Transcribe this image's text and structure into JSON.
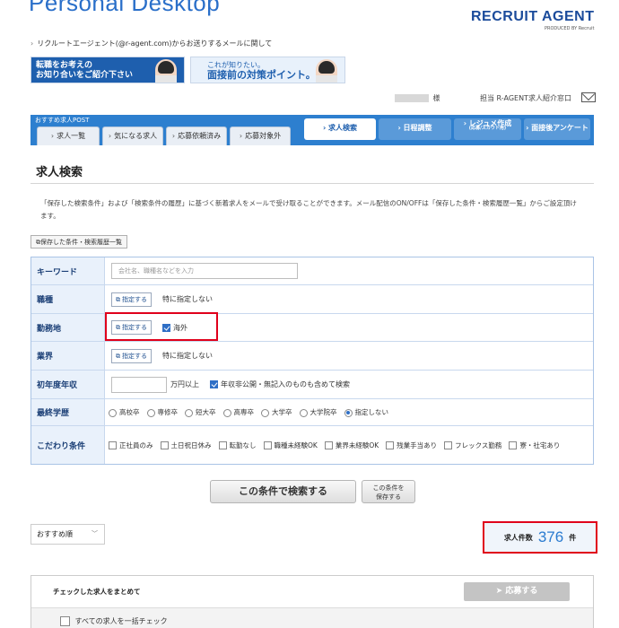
{
  "header": {
    "title": "Personal Desktop",
    "brand": "RECRUIT AGENT",
    "brand_sub": "PRODUCED BY Recruit"
  },
  "top_link": "リクルートエージェント(@r-agent.com)からお送りするメールに関して",
  "banners": {
    "left_line1": "転職をお考えの",
    "left_line2": "お知り合いをご紹介下さい",
    "right_line1": "これが知りたい。",
    "right_line2": "面接前の対策ポイント。"
  },
  "user": {
    "suffix": "様",
    "contact": "担当 R-AGENT求人紹介窓口"
  },
  "nav": {
    "label": "おすすめ求人POST",
    "tabs": [
      "求人一覧",
      "気になる求人",
      "応募依頼済み",
      "応募対象外"
    ],
    "buttons": {
      "search": "求人検索",
      "schedule": "日程調整",
      "resume": "レジュメ作成",
      "resume_sub": "(応募/スカウト用)",
      "survey": "面接後アンケート"
    }
  },
  "page": {
    "title": "求人検索",
    "description": "「保存した検索条件」および「検索条件の履歴」に基づく新着求人をメールで受け取ることができます。メール配信のON/OFFは「保存した条件・検索履歴一覧」からご設定頂けます。",
    "saved_conditions_button": "保存した条件・検索履歴一覧"
  },
  "form": {
    "keyword": {
      "label": "キーワード",
      "placeholder": "会社名、職種名などを入力"
    },
    "job_type": {
      "label": "職種",
      "button": "指定する",
      "value": "特に指定しない"
    },
    "location": {
      "label": "勤務地",
      "button": "指定する",
      "checkbox_label": "海外",
      "checked": true
    },
    "industry": {
      "label": "業界",
      "button": "指定する",
      "value": "特に指定しない"
    },
    "salary": {
      "label": "初年度年収",
      "unit": "万円以上",
      "checkbox_label": "年収非公開・無記入のものも含めて検索",
      "checked": true
    },
    "education": {
      "label": "最終学歴",
      "options": [
        "高校卒",
        "専修卒",
        "短大卒",
        "高専卒",
        "大学卒",
        "大学院卒",
        "指定しない"
      ],
      "selected": "指定しない"
    },
    "preferences": {
      "label": "こだわり条件",
      "options": [
        "正社員のみ",
        "土日祝日休み",
        "転勤なし",
        "職種未経験OK",
        "業界未経験OK",
        "残業手当あり",
        "フレックス勤務",
        "寮・社宅あり"
      ]
    }
  },
  "actions": {
    "search": "この条件で検索する",
    "save_line1": "この条件を",
    "save_line2": "保存する"
  },
  "results": {
    "sort": "おすすめ順",
    "count_label": "求人件数",
    "count": "376",
    "count_unit": "件"
  },
  "bottom": {
    "bulk_label": "チェックした求人をまとめて",
    "apply": "応募する",
    "check_all": "すべての求人を一括チェック"
  },
  "colors": {
    "accent": "#2d7fcf",
    "highlight": "#e0001b",
    "count": "#2a7bd0"
  }
}
